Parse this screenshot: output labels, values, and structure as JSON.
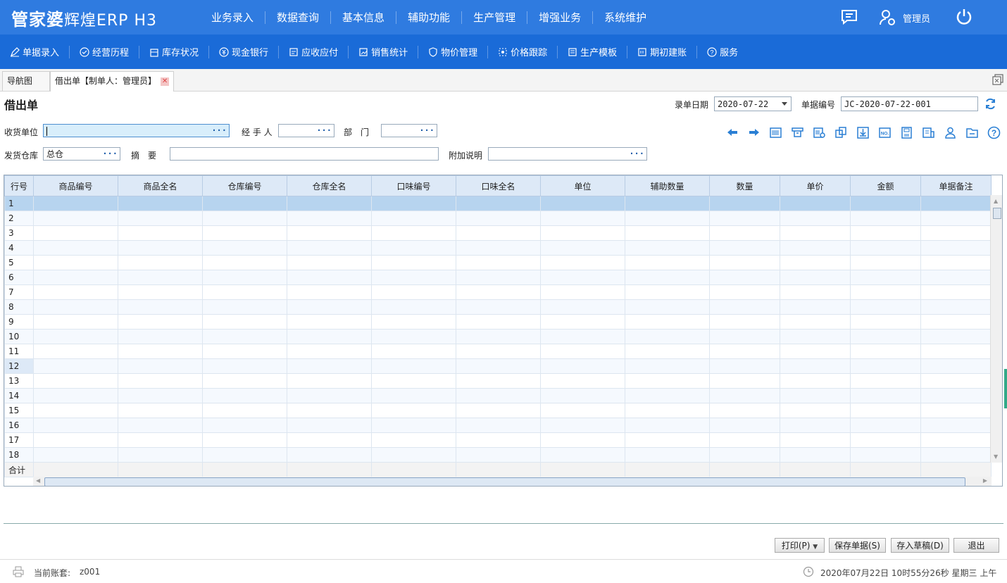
{
  "app": {
    "logo_main": "管家婆",
    "logo_sub": "辉煌ERP H3",
    "user": "管理员"
  },
  "main_menu": [
    "业务录入",
    "数据查询",
    "基本信息",
    "辅助功能",
    "生产管理",
    "增强业务",
    "系统维护"
  ],
  "sub_menu": [
    "单据录入",
    "经营历程",
    "库存状况",
    "现金银行",
    "应收应付",
    "销售统计",
    "物价管理",
    "价格跟踪",
    "生产模板",
    "期初建账",
    "服务"
  ],
  "tabs": {
    "nav": "导航图",
    "doc": "借出单【制单人：管理员】"
  },
  "form": {
    "title": "借出单",
    "date_label": "录单日期",
    "date_value": "2020-07-22",
    "number_label": "单据编号",
    "number_value": "JC-2020-07-22-001",
    "receiver_label": "收货单位",
    "receiver_value": "",
    "handler_label": "经 手 人",
    "handler_value": "",
    "dept_label": "部　门",
    "dept_value": "",
    "warehouse_label": "发货仓库",
    "warehouse_value": "总仓",
    "summary_label": "摘　要",
    "summary_value": "",
    "note_label": "附加说明",
    "note_value": ""
  },
  "grid": {
    "columns": [
      "行号",
      "商品编号",
      "商品全名",
      "仓库编号",
      "仓库全名",
      "口味编号",
      "口味全名",
      "单位",
      "辅助数量",
      "数量",
      "单价",
      "金额",
      "单据备注"
    ],
    "rows": [
      "1",
      "2",
      "3",
      "4",
      "5",
      "6",
      "7",
      "8",
      "9",
      "10",
      "11",
      "12",
      "13",
      "14",
      "15",
      "16",
      "17",
      "18"
    ],
    "total_label": "合计"
  },
  "buttons": {
    "print": "打印(P)",
    "save": "保存单据(S)",
    "draft": "存入草稿(D)",
    "exit": "退出"
  },
  "status": {
    "account_label": "当前账套:",
    "account_value": "z001",
    "datetime": "2020年07月22日 10时55分26秒 星期三 上午"
  },
  "colors": {
    "topbar": "#2f7be0",
    "subbar": "#1a6bd8",
    "grid_header": "#dde9f7",
    "selected_row": "#b7d4ef"
  }
}
